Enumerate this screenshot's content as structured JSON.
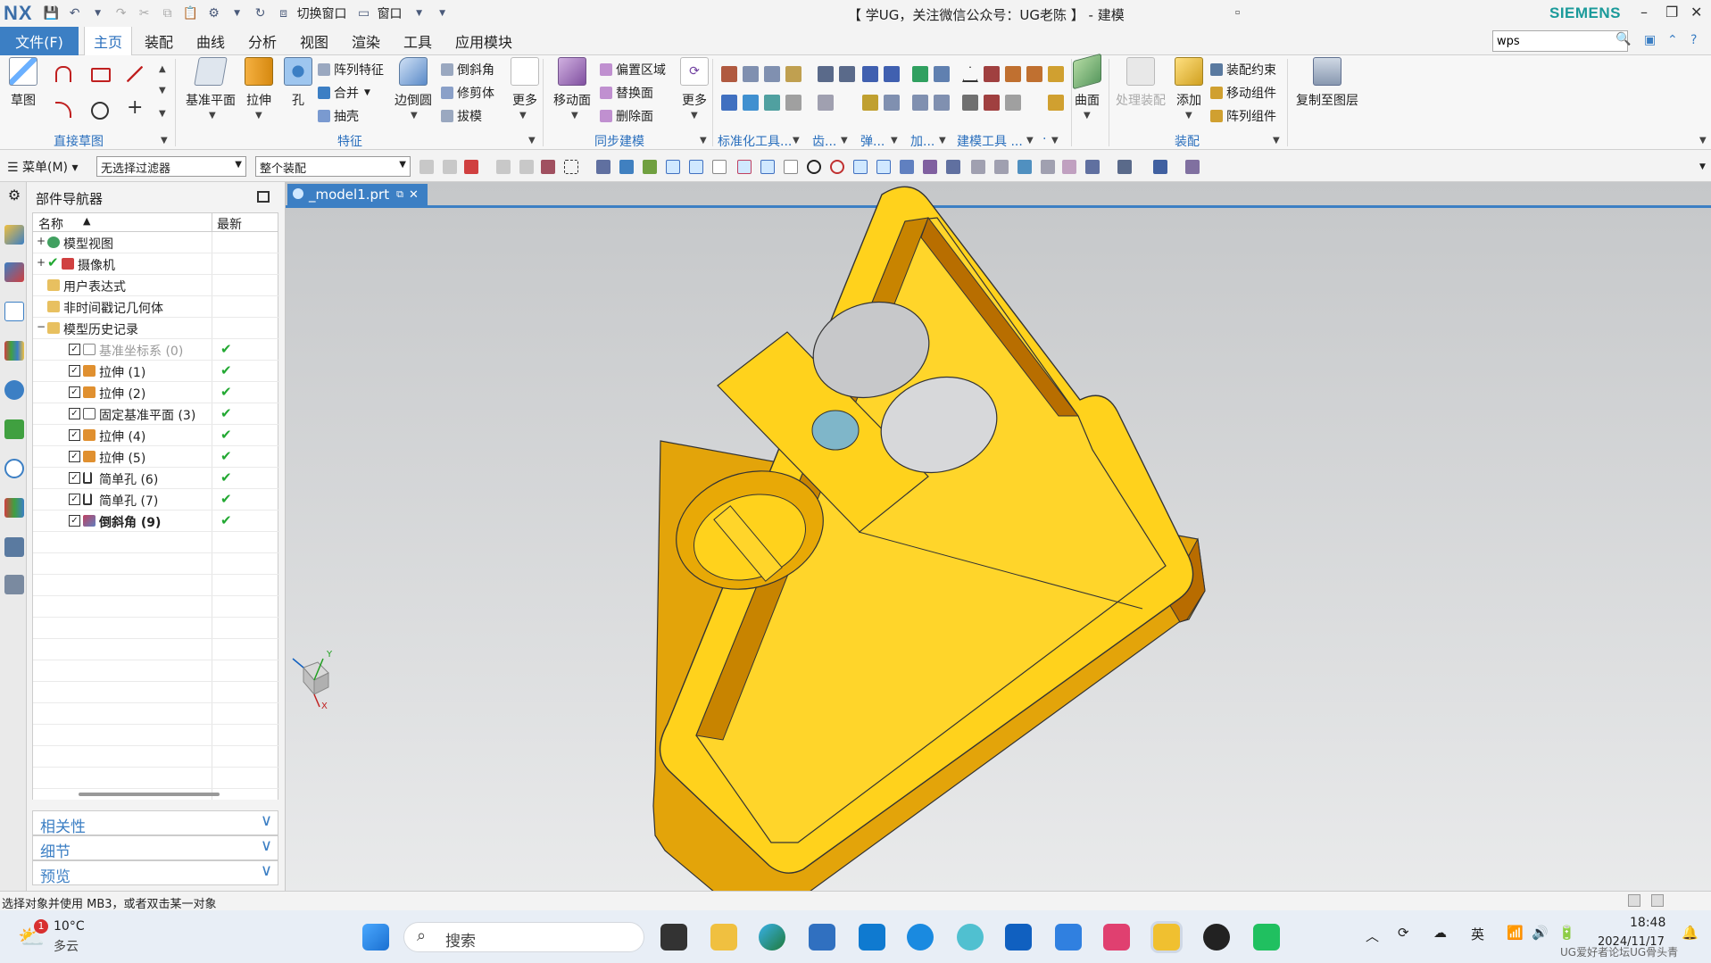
{
  "titlebar": {
    "logo": "NX",
    "switch_window": "切换窗口",
    "window_menu": "窗口",
    "title": "【 学UG，关注微信公众号：UG老陈 】 - 建模",
    "brand": "SIEMENS"
  },
  "menu": {
    "file": "文件(F)",
    "tabs": [
      "主页",
      "装配",
      "曲线",
      "分析",
      "视图",
      "渲染",
      "工具",
      "应用模块"
    ],
    "search_value": "wps"
  },
  "ribbon": {
    "sketch": "草图",
    "direct_sketch": "直接草图",
    "datum_plane": "基准平面",
    "extrude": "拉伸",
    "hole": "孔",
    "pattern_feature": "阵列特征",
    "unite": "合并",
    "shell": "抽壳",
    "edge_blend": "边倒圆",
    "chamfer": "倒斜角",
    "trim_body": "修剪体",
    "draft": "拔模",
    "more": "更多",
    "feature_group": "特征",
    "move_face": "移动面",
    "offset_region": "偏置区域",
    "replace_face": "替换面",
    "delete_face": "删除面",
    "more2": "更多",
    "sync_group": "同步建模",
    "std_tools": "标准化工具...",
    "gear": "齿...",
    "spring": "弹...",
    "add": "加...",
    "modeling_tools": "建模工具 ...",
    "dot": "·",
    "surface": "曲面",
    "process_assembly": "处理装配",
    "add_comp": "添加",
    "assembly_constraint": "装配约束",
    "move_component": "移动组件",
    "pattern_component": "阵列组件",
    "assembly_group": "装配",
    "copy_to_layer": "复制至图层"
  },
  "selbar": {
    "menu": "菜单(M)",
    "filter": "无选择过滤器",
    "scope": "整个装配"
  },
  "navigator": {
    "title": "部件导航器",
    "col_name": "名称",
    "col_latest": "最新",
    "rows": [
      {
        "label": "模型视图",
        "ok": ""
      },
      {
        "label": "摄像机",
        "ok": ""
      },
      {
        "label": "用户表达式",
        "ok": ""
      },
      {
        "label": "非时间戳记几何体",
        "ok": ""
      },
      {
        "label": "模型历史记录",
        "ok": ""
      },
      {
        "label": "基准坐标系 (0)",
        "ok": "✔"
      },
      {
        "label": "拉伸 (1)",
        "ok": "✔"
      },
      {
        "label": "拉伸 (2)",
        "ok": "✔"
      },
      {
        "label": "固定基准平面 (3)",
        "ok": "✔"
      },
      {
        "label": "拉伸 (4)",
        "ok": "✔"
      },
      {
        "label": "拉伸 (5)",
        "ok": "✔"
      },
      {
        "label": "简单孔 (6)",
        "ok": "✔"
      },
      {
        "label": "简单孔 (7)",
        "ok": "✔"
      },
      {
        "label": "倒斜角 (9)",
        "ok": "✔"
      }
    ],
    "panels": [
      "相关性",
      "细节",
      "预览"
    ]
  },
  "document": {
    "tab": "_model1.prt"
  },
  "triad": {
    "x": "X",
    "y": "Y"
  },
  "status": "选择对象并使用 MB3，或者双击某一对象",
  "taskbar": {
    "temp": "10°C",
    "weather": "多云",
    "weather_badge": "1",
    "search": "搜索",
    "ime": "英",
    "time": "18:48",
    "date": "2024/11/17",
    "watermark": "UG爱好者论坛UG骨头青"
  },
  "colors": {
    "accent": "#3c7fc4",
    "model_face": "#ffd21c",
    "model_side": "#e0a206",
    "model_dark": "#b86e00"
  }
}
